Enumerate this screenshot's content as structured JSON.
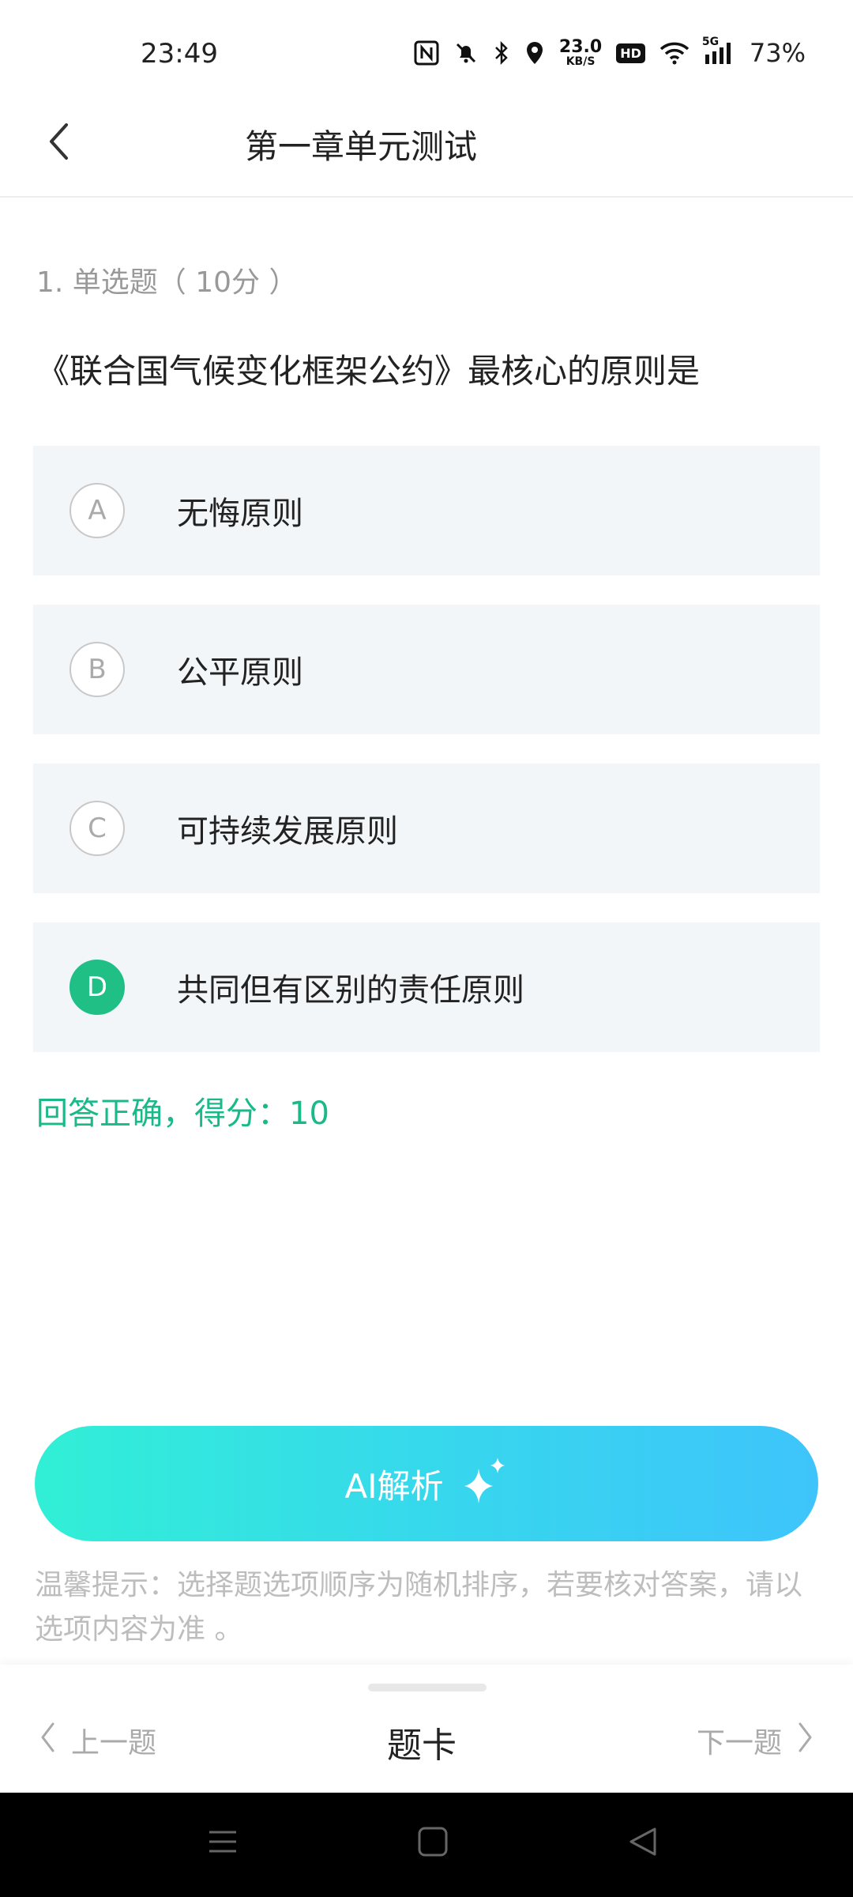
{
  "status": {
    "time": "23:49",
    "net_speed_value": "23.0",
    "net_speed_unit": "KB/S",
    "hd_label": "HD",
    "signal_label": "5G",
    "battery": "73%"
  },
  "header": {
    "title": "第一章单元测试"
  },
  "question": {
    "meta": "1. 单选题（ 10分 ）",
    "text": "《联合国气候变化框架公约》最核心的原则是",
    "options": [
      {
        "letter": "A",
        "text": "无悔原则"
      },
      {
        "letter": "B",
        "text": "公平原则"
      },
      {
        "letter": "C",
        "text": "可持续发展原则"
      },
      {
        "letter": "D",
        "text": "共同但有区别的责任原则"
      }
    ],
    "selected_option": "D",
    "result": "回答正确，得分：10"
  },
  "ai_button": {
    "label": "AI解析"
  },
  "tip": "温馨提示：选择题选项顺序为随机排序，若要核对答案，请以选项内容为准 。",
  "bottom_nav": {
    "prev": "上一题",
    "card": "题卡",
    "next": "下一题"
  },
  "colors": {
    "accent_green": "#1fbf86",
    "result_green": "#19b98a",
    "option_bg": "#f3f6f9",
    "ai_gradient_start": "#31efd6",
    "ai_gradient_end": "#3ec4fb"
  },
  "icons": {
    "back": "chevron-left-icon",
    "nfc": "nfc-icon",
    "mute": "bell-off-icon",
    "bluetooth": "bluetooth-icon",
    "location": "location-pin-icon",
    "wifi": "wifi-icon",
    "sparkle": "sparkle-icon"
  }
}
